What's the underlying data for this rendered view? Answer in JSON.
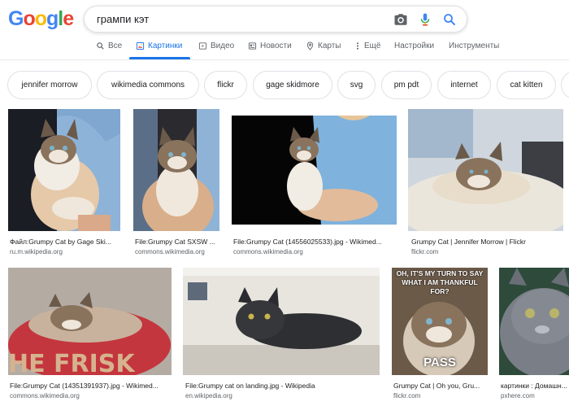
{
  "logo": {
    "letters": [
      "G",
      "o",
      "o",
      "g",
      "l",
      "e"
    ],
    "colors": [
      "#4285f4",
      "#ea4335",
      "#fbbc05",
      "#4285f4",
      "#34a853",
      "#ea4335"
    ]
  },
  "search": {
    "query": "грампи кэт"
  },
  "tabs": [
    {
      "label": "Все",
      "icon": "search-icon"
    },
    {
      "label": "Картинки",
      "icon": "image-icon"
    },
    {
      "label": "Видео",
      "icon": "video-icon"
    },
    {
      "label": "Новости",
      "icon": "news-icon"
    },
    {
      "label": "Карты",
      "icon": "map-pin-icon"
    },
    {
      "label": "Ещё",
      "icon": "more-icon"
    },
    {
      "label": "Настройки"
    },
    {
      "label": "Инструменты"
    }
  ],
  "chips": [
    "jennifer morrow",
    "wikimedia commons",
    "flickr",
    "gage skidmore",
    "svg",
    "pm pdt",
    "internet",
    "cat kitten"
  ],
  "results": [
    {
      "caption": "Файл:Grumpy Cat by Gage Ski...",
      "source": "ru.m.wikipedia.org"
    },
    {
      "caption": "File:Grumpy Cat SXSW ...",
      "source": "commons.wikimedia.org"
    },
    {
      "caption": "File:Grumpy Cat (14556025533).jpg - Wikimed...",
      "source": "commons.wikimedia.org"
    },
    {
      "caption": "Grumpy Cat | Jennifer Morrow | Flickr",
      "source": "flickr.com"
    },
    {
      "caption": "File:Grumpy Cat (14351391937).jpg - Wikimed...",
      "source": "commons.wikimedia.org"
    },
    {
      "caption": "File:Grumpy cat on landing.jpg - Wikipedia",
      "source": "en.wikipedia.org"
    },
    {
      "caption": "Grumpy Cat | Oh you, Gru...",
      "source": "flickr.com",
      "meme_top": "OH, IT'S MY TURN TO SAY WHAT I AM THANKFUL FOR?",
      "meme_bottom": "PASS"
    },
    {
      "caption": "картинки : Домашн...",
      "source": "pxhere.com"
    }
  ],
  "colors": {
    "accent": "#1a73e8",
    "muted": "#5f6368"
  }
}
